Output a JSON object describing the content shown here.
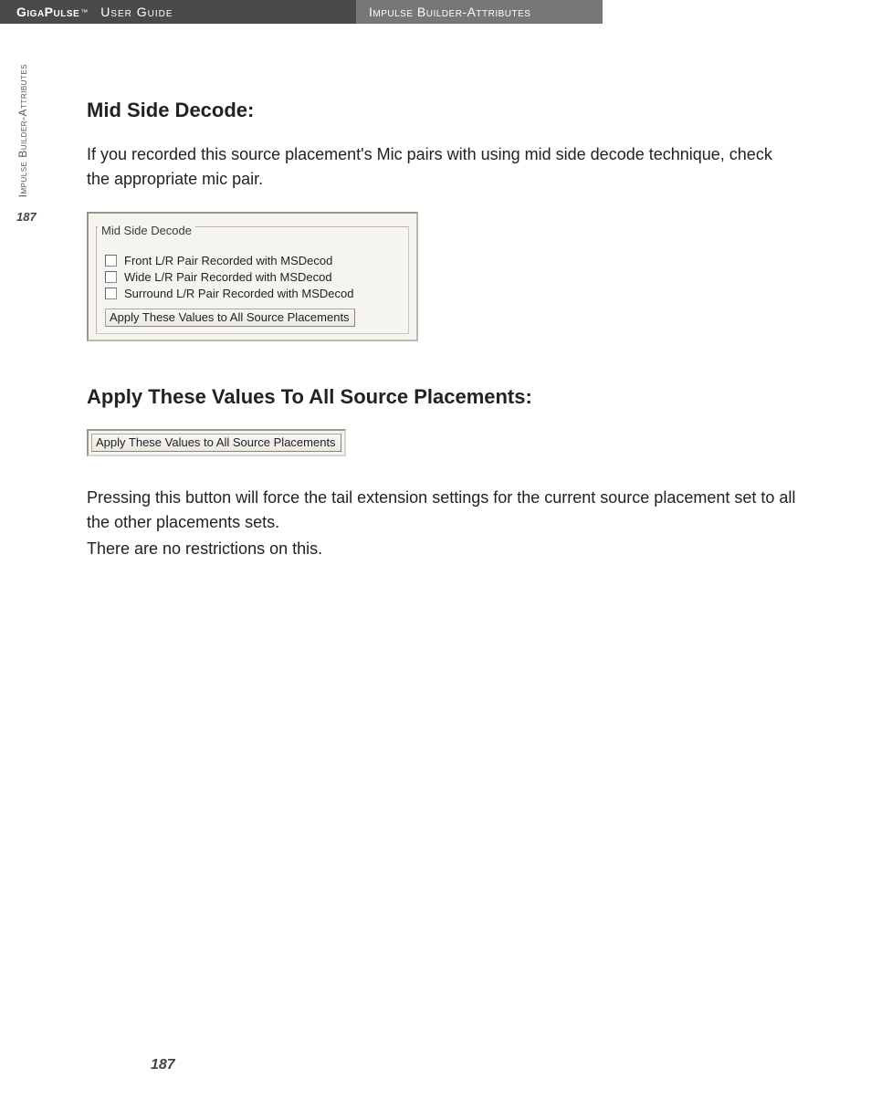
{
  "header": {
    "brand": "GigaPulse",
    "tm": "™",
    "subtitle": "User Guide",
    "section": "Impulse Builder-Attributes"
  },
  "sidebar": {
    "label": "Impulse Builder-Attributes",
    "page": "187"
  },
  "section1": {
    "title": "Mid Side Decode:",
    "body": "If you recorded this source placement's Mic pairs with using mid side decode technique, check the appropriate mic pair.",
    "panel": {
      "legend": "Mid Side Decode",
      "check1": "Front L/R Pair Recorded with MSDecod",
      "check2": "Wide L/R Pair Recorded with MSDecod",
      "check3": "Surround L/R Pair Recorded with MSDecod",
      "button": "Apply These Values to All Source Placements"
    }
  },
  "section2": {
    "title": "Apply These Values To All Source Placements:",
    "button": "Apply These Values to All Source Placements",
    "body1": "Pressing this button will force the tail extension settings for the current source placement set to all the other placements sets.",
    "body2": "There are no restrictions on this."
  },
  "footer": {
    "page": "187"
  }
}
